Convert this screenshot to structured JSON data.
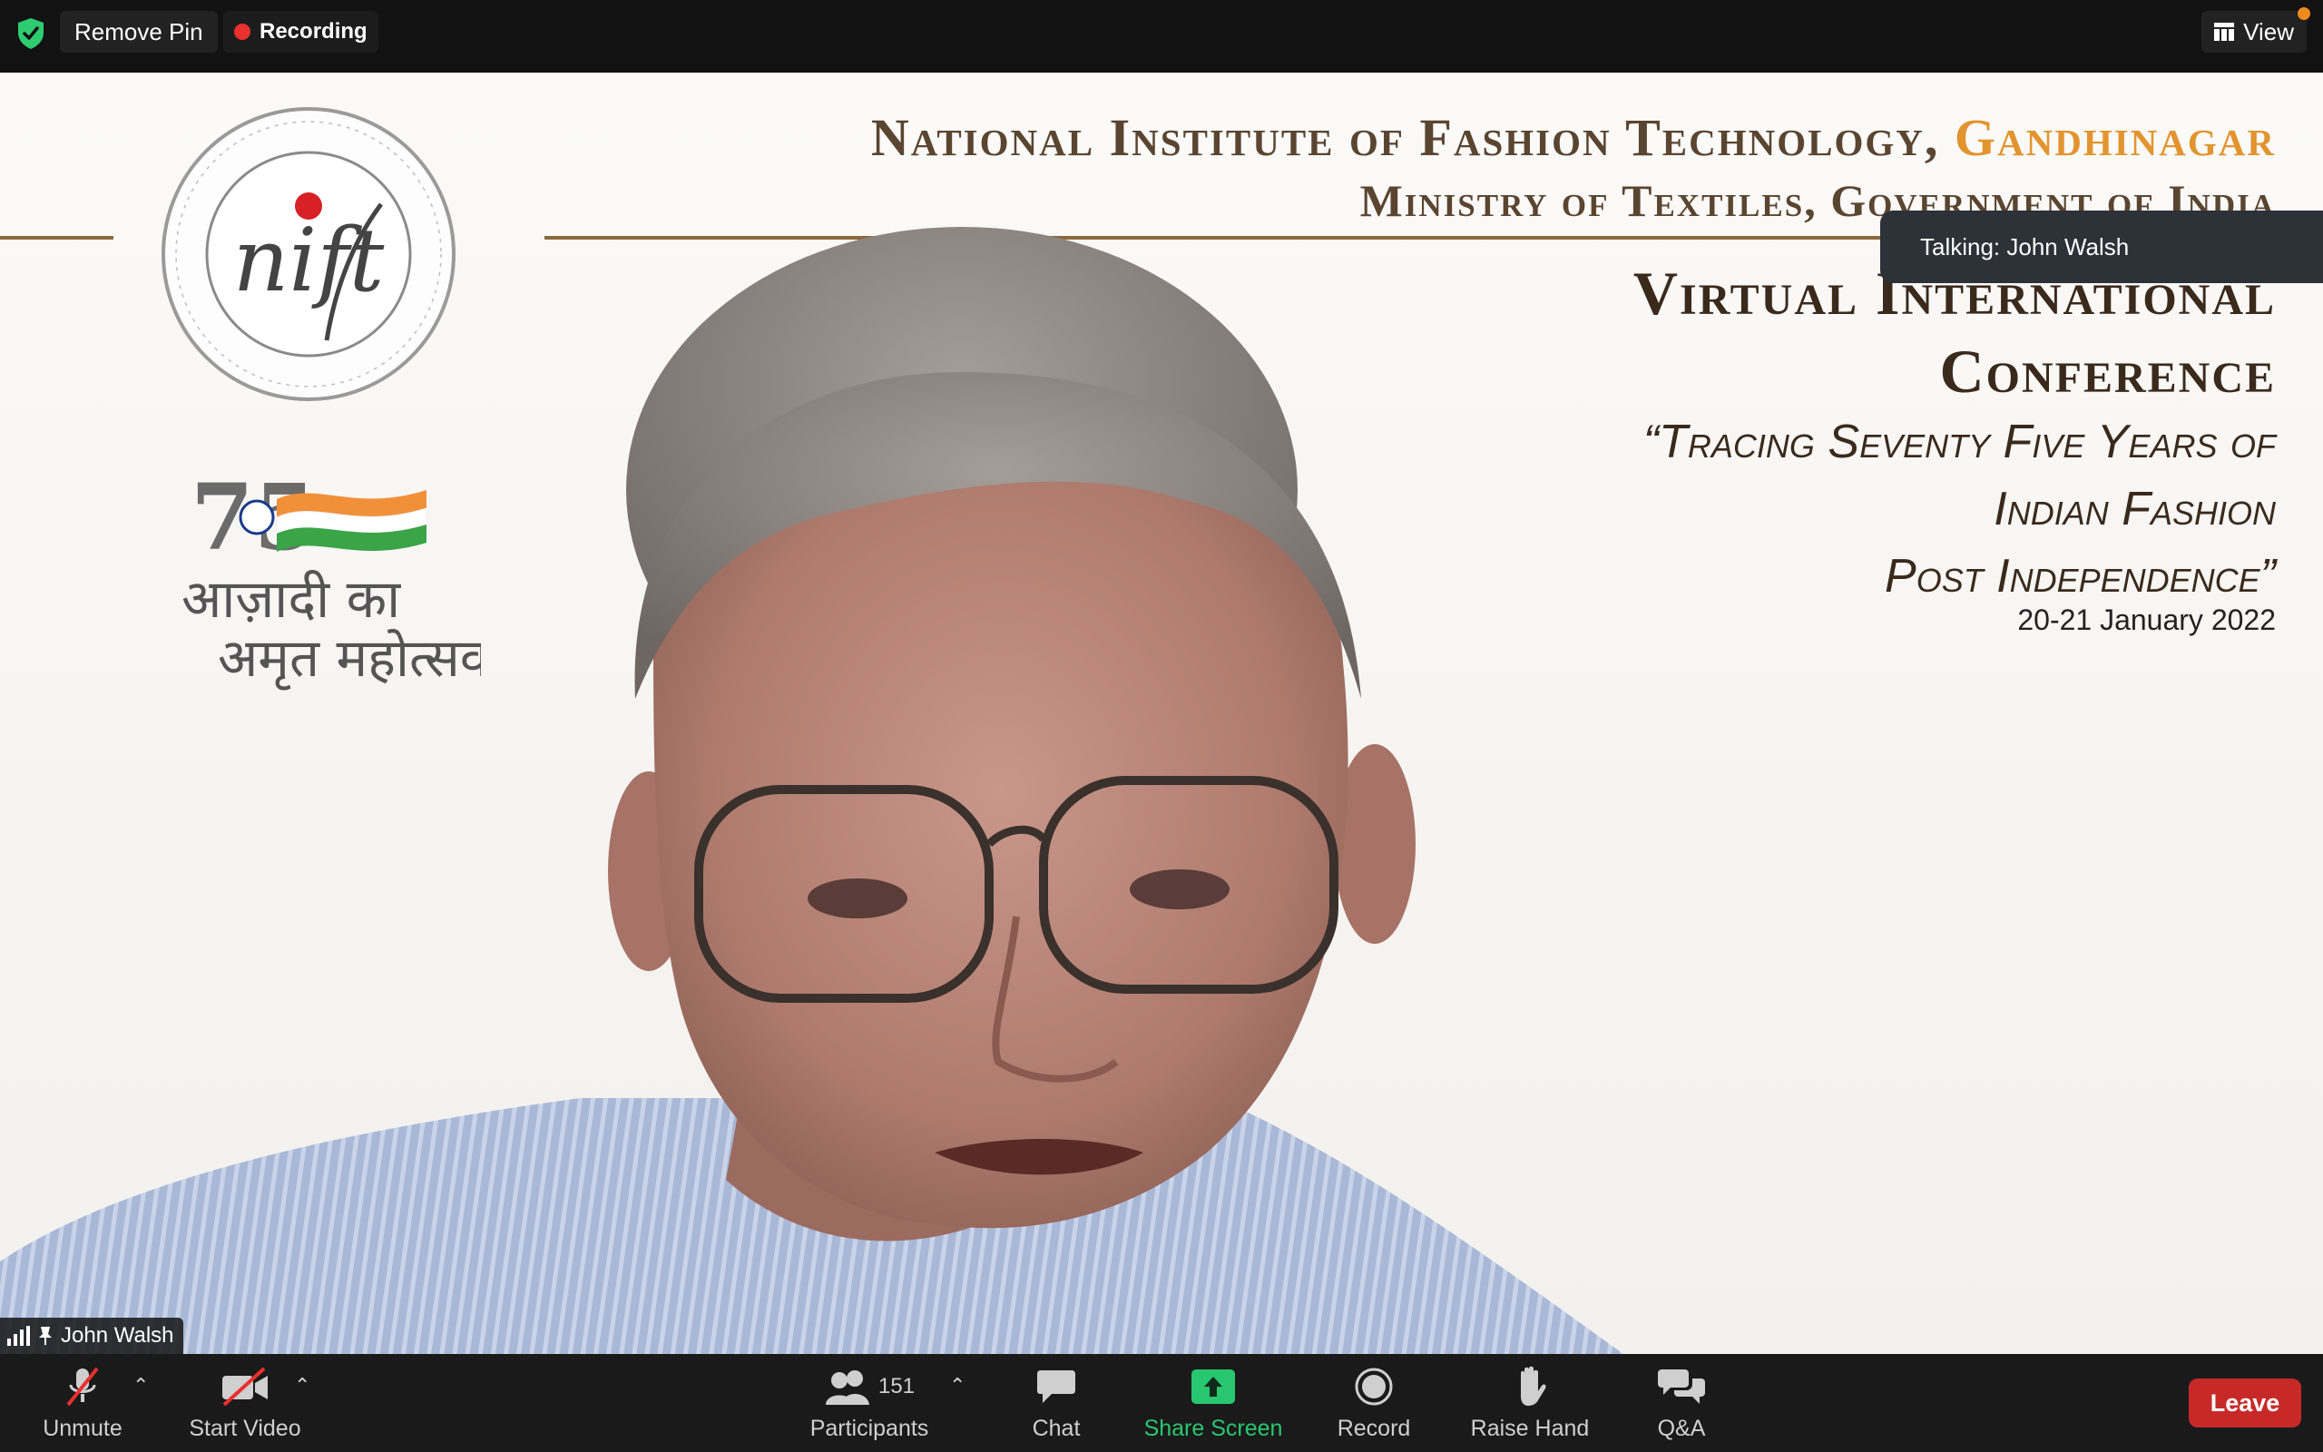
{
  "topbar": {
    "remove_pin_label": "Remove Pin",
    "recording_label": "Recording",
    "view_label": "View",
    "colors": {
      "shield": "#2ecc71",
      "recording_dot": "#e8312f",
      "view_badge": "#f08a1c"
    }
  },
  "slide": {
    "institute_prefix": "National Institute of Fashion Technology, ",
    "institute_city": "Gandhinagar",
    "ministry": "Ministry of Textiles, Government of India",
    "conference_title_line1": "Virtual International",
    "conference_title_line2": "Conference",
    "theme_line1": "“Tracing Seventy Five Years of",
    "theme_line2": "Indian Fashion",
    "theme_line3": "Post Independence”",
    "date": "20-21 January 2022",
    "logo_text": "nift",
    "azadi_line1": "आज़ादी का",
    "azadi_line2": "अमृत महोत्सव",
    "azadi_number": "75",
    "accent_color": "#e2942f"
  },
  "video": {
    "talking_label": "Talking: John Walsh",
    "participant_name": "John Walsh"
  },
  "toolbar": {
    "unmute_label": "Unmute",
    "start_video_label": "Start Video",
    "participants_label": "Participants",
    "participants_count": "151",
    "chat_label": "Chat",
    "share_screen_label": "Share Screen",
    "record_label": "Record",
    "raise_hand_label": "Raise Hand",
    "qa_label": "Q&A",
    "leave_label": "Leave",
    "colors": {
      "share": "#28c76f",
      "leave": "#c72929",
      "muted_slash": "#e8312f"
    }
  }
}
